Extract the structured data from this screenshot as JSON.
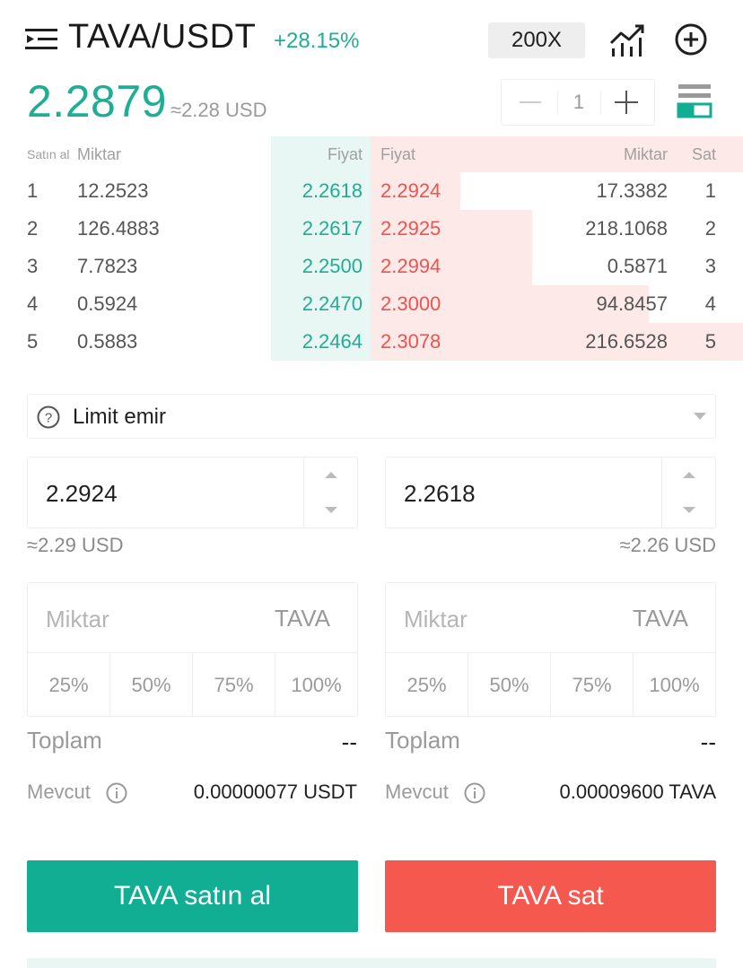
{
  "header": {
    "pair": "TAVA/USDT",
    "change": "+28.15%",
    "leverage": "200X",
    "last_price": "2.2879",
    "last_price_usd": "≈2.28 USD",
    "depth_step": "1"
  },
  "orderbook": {
    "headers": {
      "buy": "Satın al",
      "buy_qty": "Miktar",
      "bid_price": "Fiyat",
      "ask_price": "Fiyat",
      "ask_qty": "Miktar",
      "sell": "Sat"
    },
    "bids": [
      {
        "idx": "1",
        "qty": "12.2523",
        "price": "2.2618"
      },
      {
        "idx": "2",
        "qty": "126.4883",
        "price": "2.2617"
      },
      {
        "idx": "3",
        "qty": "7.7823",
        "price": "2.2500"
      },
      {
        "idx": "4",
        "qty": "0.5924",
        "price": "2.2470"
      },
      {
        "idx": "5",
        "qty": "0.5883",
        "price": "2.2464"
      }
    ],
    "asks": [
      {
        "idx": "1",
        "qty": "17.3382",
        "price": "2.2924"
      },
      {
        "idx": "2",
        "qty": "218.1068",
        "price": "2.2925"
      },
      {
        "idx": "3",
        "qty": "0.5871",
        "price": "2.2994"
      },
      {
        "idx": "4",
        "qty": "94.8457",
        "price": "2.3000"
      },
      {
        "idx": "5",
        "qty": "216.6528",
        "price": "2.3078"
      }
    ]
  },
  "order_type": "Limit emir",
  "buy_panel": {
    "price": "2.2924",
    "price_usd": "≈2.29 USD",
    "amount_placeholder": "Miktar",
    "amount_unit": "TAVA",
    "percents": [
      "25%",
      "50%",
      "75%",
      "100%"
    ],
    "total_label": "Toplam",
    "total_value": "--",
    "available_label": "Mevcut",
    "available_value": "0.00000077 USDT",
    "button": "TAVA satın al"
  },
  "sell_panel": {
    "price": "2.2618",
    "price_usd": "≈2.26 USD",
    "amount_placeholder": "Miktar",
    "amount_unit": "TAVA",
    "percents": [
      "25%",
      "50%",
      "75%",
      "100%"
    ],
    "total_label": "Toplam",
    "total_value": "--",
    "available_label": "Mevcut",
    "available_value": "0.00009600 TAVA",
    "button": "TAVA sat"
  },
  "colors": {
    "buy": "#12ae94",
    "sell": "#f5584f",
    "bid_fill": "#e8f7f3",
    "ask_fill": "#fde9e8"
  }
}
